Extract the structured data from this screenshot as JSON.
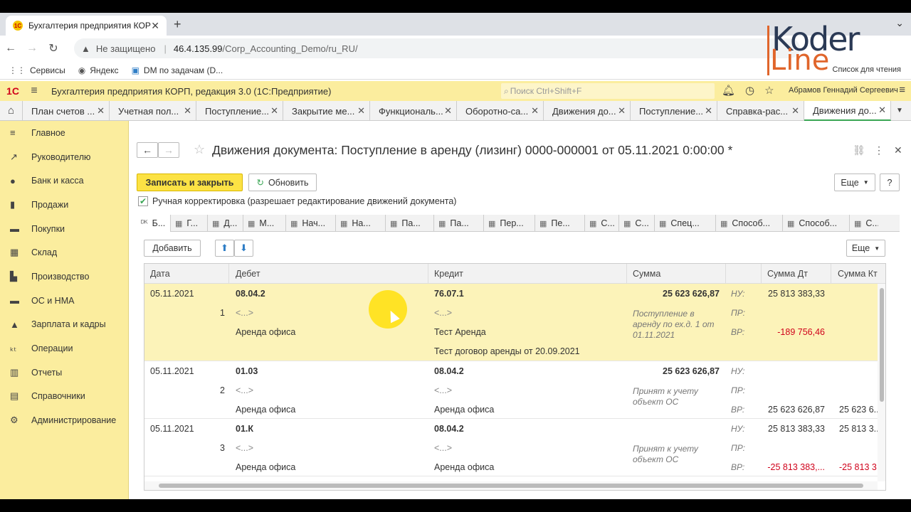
{
  "browser": {
    "tab_title": "Бухгалтерия предприятия КОРП",
    "tab_icon": "1С",
    "insecure_label": "Не защищено",
    "url_host": "46.4.135.99",
    "url_path": "/Corp_Accounting_Demo/ru_RU/",
    "bookmarks": [
      "Сервисы",
      "Яндекс",
      "DM по задачам (D..."
    ],
    "reading_list": "Список для чтения"
  },
  "logo": {
    "top": "Koder",
    "bottom": "Line"
  },
  "app": {
    "logo": "1С",
    "title": "Бухгалтерия предприятия КОРП, редакция 3.0  (1С:Предприятие)",
    "search_placeholder": "Поиск Ctrl+Shift+F",
    "user": "Абрамов Геннадий Сергеевич"
  },
  "open_tabs": [
    "План счетов ...",
    "Учетная пол...",
    "Поступление...",
    "Закрытие ме...",
    "Функциональ...",
    "Оборотно-са...",
    "Движения до...",
    "Поступление...",
    "Справка-рас...",
    "Движения до..."
  ],
  "sidebar": [
    {
      "label": "Главное",
      "icon": "menu-icon",
      "glyph": "≡"
    },
    {
      "label": "Руководителю",
      "icon": "trend-icon",
      "glyph": "↗"
    },
    {
      "label": "Банк и касса",
      "icon": "coin-icon",
      "glyph": "●"
    },
    {
      "label": "Продажи",
      "icon": "bag-icon",
      "glyph": "▮"
    },
    {
      "label": "Покупки",
      "icon": "cart-icon",
      "glyph": "▬"
    },
    {
      "label": "Склад",
      "icon": "warehouse-icon",
      "glyph": "▦"
    },
    {
      "label": "Производство",
      "icon": "factory-icon",
      "glyph": "▙"
    },
    {
      "label": "ОС и НМА",
      "icon": "truck-icon",
      "glyph": "▬"
    },
    {
      "label": "Зарплата и кадры",
      "icon": "person-icon",
      "glyph": "▲"
    },
    {
      "label": "Операции",
      "icon": "operations-icon",
      "glyph": "ₖₜ"
    },
    {
      "label": "Отчеты",
      "icon": "chart-icon",
      "glyph": "▥"
    },
    {
      "label": "Справочники",
      "icon": "book-icon",
      "glyph": "▤"
    },
    {
      "label": "Администрирование",
      "icon": "gear-icon",
      "glyph": "⚙"
    }
  ],
  "document": {
    "title": "Движения документа: Поступление в аренду (лизинг) 0000-000001 от 05.11.2021 0:00:00 *",
    "save_close": "Записать и закрыть",
    "refresh": "Обновить",
    "more": "Еще",
    "help": "?",
    "manual_correction": "Ручная корректировка (разрешает редактирование движений документа)"
  },
  "register_tabs": [
    "Б...",
    "Г...",
    "Д...",
    "М...",
    "Нач...",
    "На...",
    "Па...",
    "Па...",
    "Пер...",
    "Пе...",
    "С...",
    "С...",
    "Спец...",
    "Способ...",
    "Способ...",
    "С..."
  ],
  "table": {
    "add": "Добавить",
    "more": "Еще",
    "columns": [
      "Дата",
      "Дебет",
      "Кредит",
      "Сумма",
      "Сумма Дт",
      "Сумма Кт"
    ],
    "rows": [
      {
        "date": "05.11.2021",
        "num": "1",
        "debit": "08.04.2",
        "debit_sub1": "<...>",
        "debit_sub2": "Аренда офиса",
        "credit": "76.07.1",
        "credit_sub1": "<...>",
        "credit_sub2": "Тест Аренда",
        "credit_sub3": "Тест договор аренды от 20.09.2021",
        "sum": "25 623 626,87",
        "content": "Поступление в аренду по ех.д. 1 от 01.11.2021",
        "nu": "НУ:",
        "pr": "ПР:",
        "vr": "ВР:",
        "sum_dt_nu": "25 813 383,33",
        "sum_dt_vr": "-189 756,46",
        "sum_kt_nu": "",
        "sum_kt_vr": ""
      },
      {
        "date": "05.11.2021",
        "num": "2",
        "debit": "01.03",
        "debit_sub1": "<...>",
        "debit_sub2": "Аренда офиса",
        "credit": "08.04.2",
        "credit_sub1": "<...>",
        "credit_sub2": "Аренда офиса",
        "credit_sub3": "",
        "sum": "25 623 626,87",
        "content": "Принят к учету объект ОС",
        "nu": "НУ:",
        "pr": "ПР:",
        "vr": "ВР:",
        "sum_dt_nu": "",
        "sum_dt_vr": "25 623 626,87",
        "sum_kt_nu": "",
        "sum_kt_vr": "25 623 6..."
      },
      {
        "date": "05.11.2021",
        "num": "3",
        "debit": "01.К",
        "debit_sub1": "<...>",
        "debit_sub2": "Аренда офиса",
        "credit": "08.04.2",
        "credit_sub1": "<...>",
        "credit_sub2": "Аренда офиса",
        "credit_sub3": "",
        "sum": "",
        "content": "Принят к учету объект ОС",
        "nu": "НУ:",
        "pr": "ПР:",
        "vr": "ВР:",
        "sum_dt_nu": "25 813 383,33",
        "sum_dt_vr": "-25 813 383,...",
        "sum_kt_nu": "25 813 3...",
        "sum_kt_vr": "-25 813 3..."
      }
    ]
  },
  "colors": {
    "panel_yellow": "#fbed9e",
    "row_highlight": "#fcf3b9",
    "primary_button": "#fce244",
    "negative": "#d0021b",
    "active_tab_accent": "#3aa655"
  }
}
